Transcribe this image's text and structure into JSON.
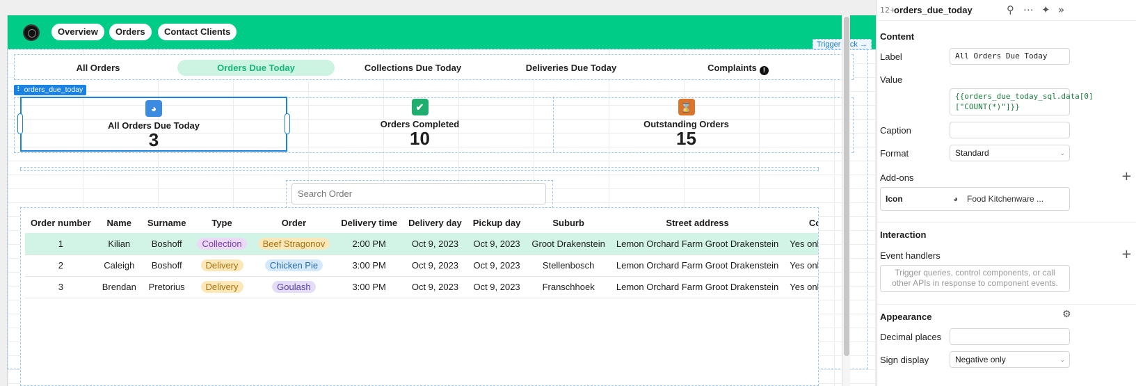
{
  "nav": {
    "items": [
      "Overview",
      "Orders",
      "Contact Clients"
    ]
  },
  "trigger": "Trigger click →",
  "tabs": {
    "all_orders": "All Orders",
    "orders_due_today": "Orders Due Today",
    "collections_due_today": "Collections Due Today",
    "deliveries_due_today": "Deliveries Due Today",
    "complaints": "Complaints"
  },
  "component_tag": "⠇ orders_due_today",
  "stats": [
    {
      "label": "All Orders Due Today",
      "value": "3",
      "icon": "bowl-food-icon",
      "color": "#3b8be0"
    },
    {
      "label": "Orders Completed",
      "value": "10",
      "icon": "check-badge-icon",
      "color": "#1fae6e"
    },
    {
      "label": "Outstanding Orders",
      "value": "15",
      "icon": "hourglass-icon",
      "color": "#d9762b"
    }
  ],
  "search": {
    "placeholder": "Search Order"
  },
  "table": {
    "columns": [
      "Order number",
      "Name",
      "Surname",
      "Type",
      "Order",
      "Delivery time",
      "Delivery day",
      "Pickup day",
      "Suburb",
      "Street address",
      "Commer"
    ],
    "rows": [
      [
        "1",
        "Kilian",
        "Boshoff",
        "Collection",
        "Beef Stragonov",
        "2:00 PM",
        "Oct 9, 2023",
        "Oct 9, 2023",
        "Groot Drakenstein",
        "Lemon Orchard Farm Groot Drakenstein",
        "Yes only want ironi"
      ],
      [
        "2",
        "Caleigh",
        "Boshoff",
        "Delivery",
        "Chicken Pie",
        "3:00 PM",
        "Oct 9, 2023",
        "Oct 9, 2023",
        "Stellenbosch",
        "Lemon Orchard Farm Groot Drakenstein",
        "Yes only want ironi"
      ],
      [
        "3",
        "Brendan",
        "Pretorius",
        "Delivery",
        "Goulash",
        "3:00 PM",
        "Oct 9, 2023",
        "Oct 9, 2023",
        "Franschhoek",
        "Lemon Orchard Farm Groot Drakenstein",
        "Yes only want ironi"
      ]
    ],
    "pill_colors": {
      "Collection": "#ebd9f7",
      "Delivery": "#fbe7b8",
      "Beef Stragonov": "#fbe7b8",
      "Chicken Pie": "#d4e9fb",
      "Goulash": "#e5dcf7"
    },
    "pill_text_colors": {
      "Collection": "#7b3fae",
      "Delivery": "#a8720c",
      "Beef Stragonov": "#a8720c",
      "Chicken Pie": "#2569a8",
      "Goulash": "#5b3fa0"
    }
  },
  "inspector": {
    "type_icon": "12+",
    "title": "orders_due_today",
    "content_title": "Content",
    "label_label": "Label",
    "label_value": "All Orders Due Today",
    "value_label": "Value",
    "value_line1": "{{orders_due_today_sql.data[0]",
    "value_line2": "[\"COUNT(*)\"]}}",
    "caption_label": "Caption",
    "format_label": "Format",
    "format_value": "Standard",
    "addons_label": "Add-ons",
    "icon_label": "Icon",
    "icon_value": "Food Kitchenware ...",
    "interaction_title": "Interaction",
    "event_handlers_label": "Event handlers",
    "event_placeholder": "Trigger queries, control components, or call other APIs in response to component events.",
    "appearance_title": "Appearance",
    "decimal_label": "Decimal places",
    "sign_label": "Sign display",
    "sign_value": "Negative only"
  }
}
